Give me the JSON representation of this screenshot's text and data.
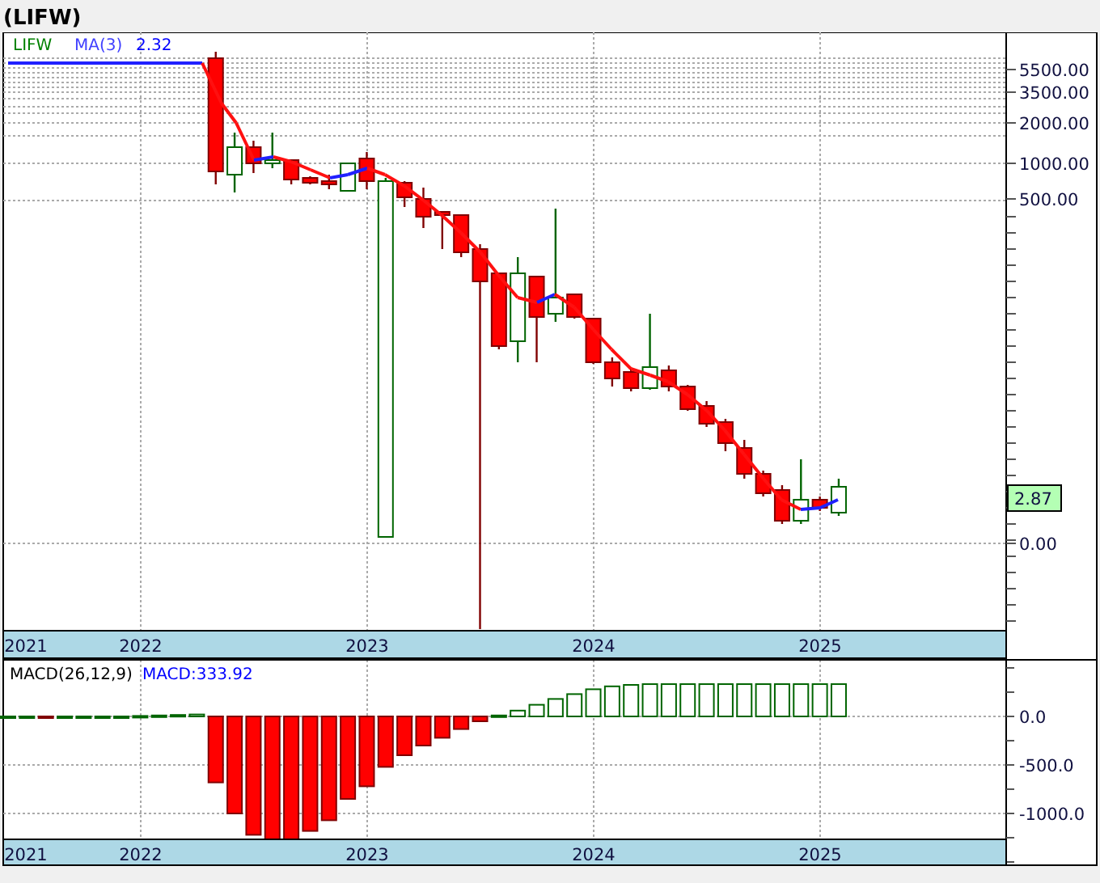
{
  "title": "(LIFW)",
  "price_panel": {
    "legend": [
      {
        "text": "LIFW",
        "color": "#008000"
      },
      {
        "text": "MA(3)",
        "color": "#4040ff"
      },
      {
        "text": "2.32",
        "color": "#0000ff"
      }
    ],
    "axis_labels": [
      "5500.00",
      "3500.00",
      "2000.00",
      "1000.00",
      "500.00",
      "0.00"
    ],
    "last_price": "2.87",
    "date_labels": [
      "2021",
      "2022",
      "2023",
      "2024",
      "2025"
    ]
  },
  "macd_panel": {
    "legend": [
      {
        "text": "MACD(26,12,9)",
        "color": "#000000"
      },
      {
        "text": "MACD:333.92",
        "color": "#0000ff"
      }
    ],
    "date_labels": [
      "2021",
      "2022",
      "2023",
      "2024",
      "2025"
    ],
    "axis_labels": [
      "0.0",
      "-500.0",
      "-1000.0"
    ]
  }
}
